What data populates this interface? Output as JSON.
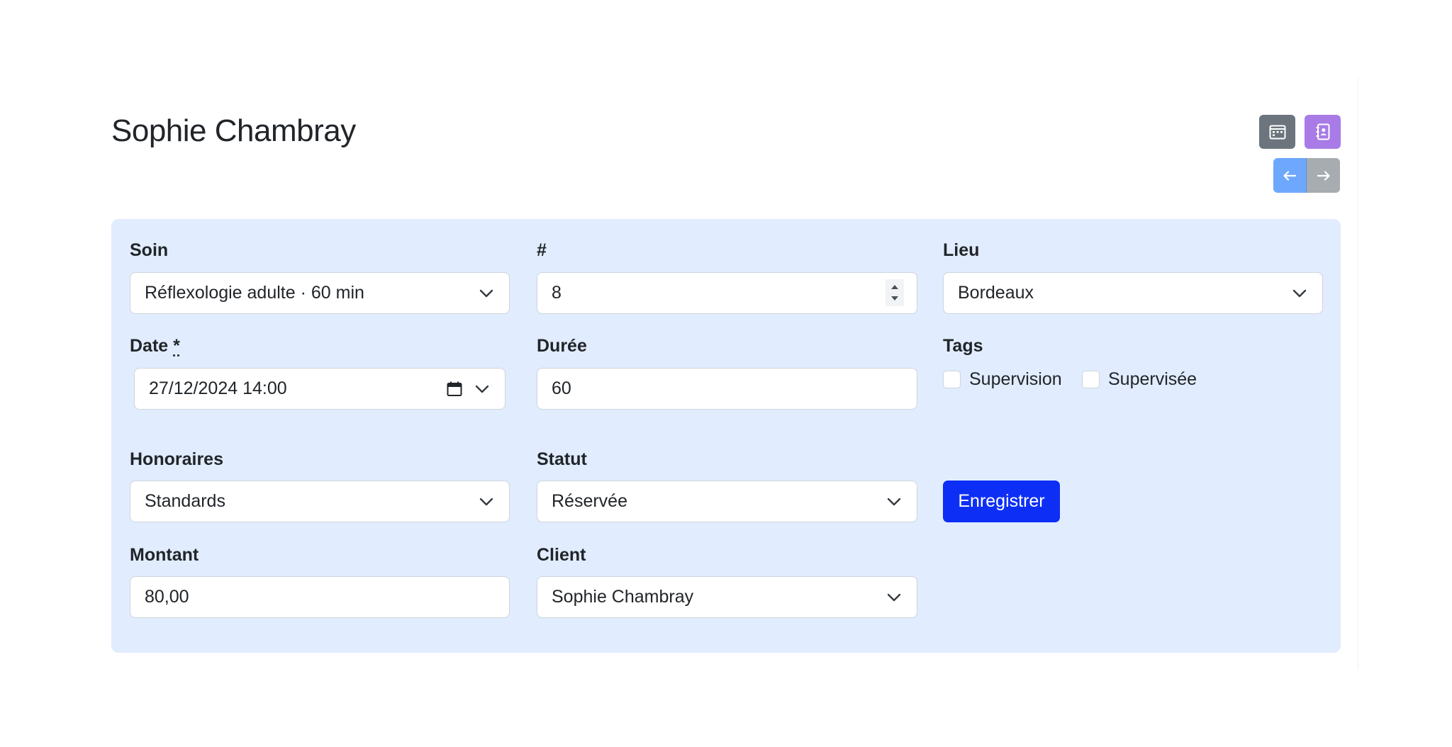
{
  "header": {
    "title": "Sophie Chambray",
    "calendar_icon": "calendar-icon",
    "contact_icon": "contact-book-icon",
    "prev_icon": "arrow-left-icon",
    "next_icon": "arrow-right-icon"
  },
  "form": {
    "soin": {
      "label": "Soin",
      "value": "Réflexologie adulte · 60 min"
    },
    "number": {
      "label": "#",
      "value": "8"
    },
    "lieu": {
      "label": "Lieu",
      "value": "Bordeaux"
    },
    "date": {
      "label": "Date",
      "required_marker": "*",
      "value": "27/12/2024 14:00"
    },
    "duree": {
      "label": "Durée",
      "value": "60"
    },
    "tags": {
      "label": "Tags",
      "options": [
        {
          "label": "Supervision",
          "checked": false
        },
        {
          "label": "Supervisée",
          "checked": false
        }
      ]
    },
    "honoraires": {
      "label": "Honoraires",
      "value": "Standards"
    },
    "statut": {
      "label": "Statut",
      "value": "Réservée"
    },
    "save_label": "Enregistrer",
    "montant": {
      "label": "Montant",
      "value": "80,00"
    },
    "client": {
      "label": "Client",
      "value": "Sophie Chambray"
    }
  },
  "colors": {
    "card_background": "#e1ecfe",
    "primary": "#0d2ff5",
    "calendar_button": "#6c757d",
    "contact_button": "#a87be6",
    "prev_button": "#6ea8fe",
    "next_button": "#a7acb1"
  }
}
